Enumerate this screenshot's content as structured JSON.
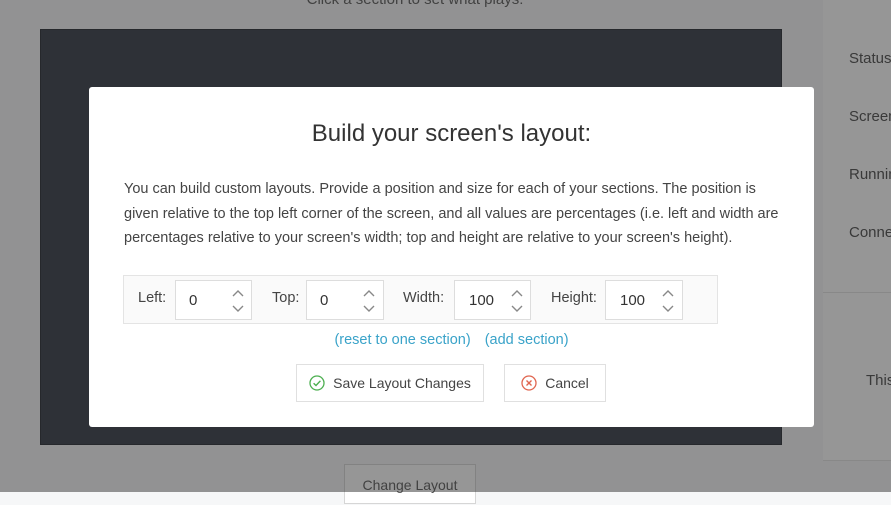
{
  "background": {
    "hint": "Click a section to set what plays:",
    "side_panel": {
      "items": [
        "Status",
        "Screen",
        "Running",
        "Connected"
      ],
      "bottom_text": "This"
    },
    "change_layout_label": "Change Layout"
  },
  "modal": {
    "title": "Build your screen's layout:",
    "description": "You can build custom layouts. Provide a position and size for each of your sections. The position is given relative to the top left corner of the screen, and all values are percentages (i.e. left and width are percentages relative to your screen's width; top and height are relative to your screen's height).",
    "fields": [
      {
        "label": "Left:",
        "value": "0"
      },
      {
        "label": "Top:",
        "value": "0"
      },
      {
        "label": "Width:",
        "value": "100"
      },
      {
        "label": "Height:",
        "value": "100"
      }
    ],
    "links": {
      "reset": "(reset to one section)",
      "add": "(add section)"
    },
    "buttons": {
      "save": "Save Layout Changes",
      "cancel": "Cancel"
    }
  },
  "colors": {
    "link": "#3aa3c9",
    "save_icon": "#4caf50",
    "cancel_icon": "#e0654f",
    "overlay": "rgba(45,45,45,0.5)"
  },
  "icons": {
    "save": "check-circle-icon",
    "cancel": "x-circle-icon",
    "spinner": "chevron-up-down-icon"
  }
}
